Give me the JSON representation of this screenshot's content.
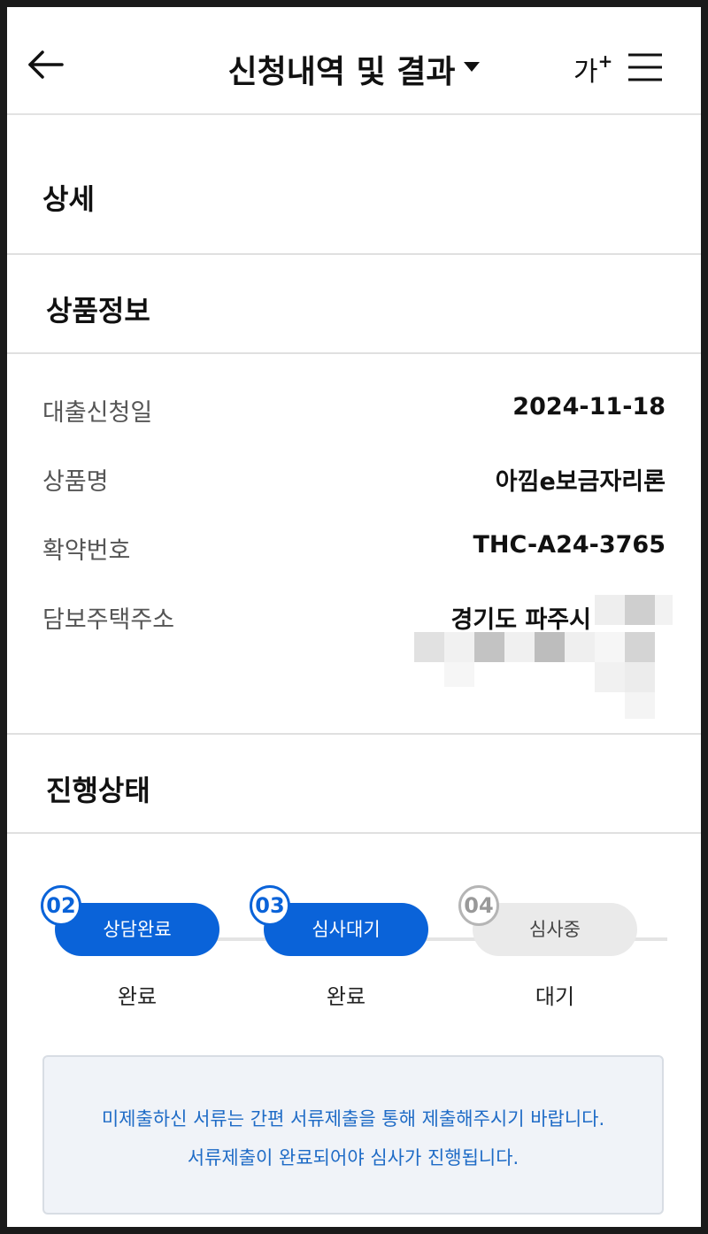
{
  "appbar": {
    "title": "신청내역 및 결과",
    "font_size_label": "가",
    "font_size_plus": "+",
    "icons": {
      "back": "back-arrow-icon",
      "dropdown": "caret-down-icon",
      "menu": "hamburger-menu-icon"
    }
  },
  "sections": {
    "detail": "상세",
    "product": "상품정보",
    "progress": "진행상태"
  },
  "product_info": {
    "rows": [
      {
        "label": "대출신청일",
        "value": "2024-11-18"
      },
      {
        "label": "상품명",
        "value": "아낌e보금자리론"
      },
      {
        "label": "확약번호",
        "value": "THC-A24-3765"
      },
      {
        "label": "담보주택주소",
        "value": "경기도 파주시"
      }
    ]
  },
  "steps": [
    {
      "number": "02",
      "name": "상담완료",
      "status": "완료",
      "state": "done"
    },
    {
      "number": "03",
      "name": "심사대기",
      "status": "완료",
      "state": "done"
    },
    {
      "number": "04",
      "name": "심사중",
      "status": "대기",
      "state": "wait"
    }
  ],
  "notice": {
    "line1": "미제출하신 서류는 간편 서류제출을 통해 제출해주시기 바랍니다.",
    "line2": "서류제출이 완료되어야 심사가 진행됩니다."
  },
  "colors": {
    "accent": "#0a63d9",
    "notice_text": "#1e6bc6",
    "notice_bg": "#f0f3f8",
    "pending_pill": "#eaeaea"
  }
}
